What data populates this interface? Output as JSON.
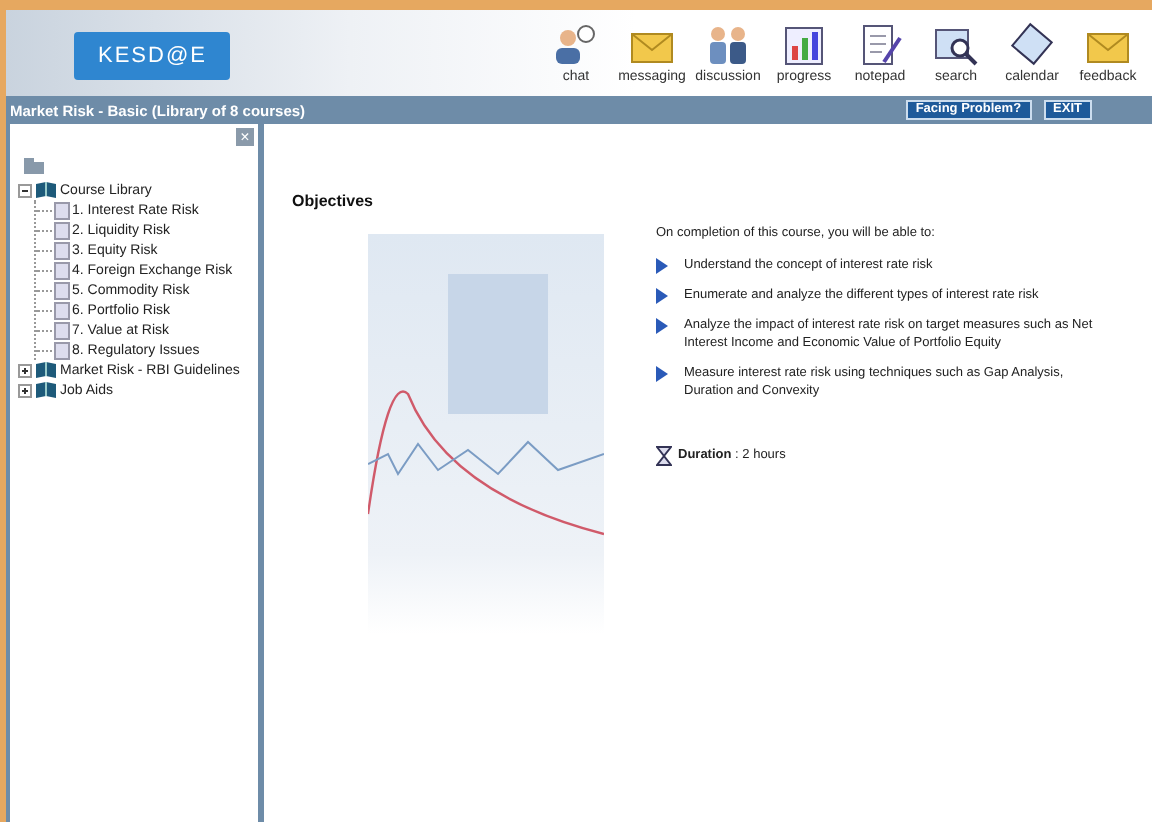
{
  "header": {
    "logo": "KESD@E",
    "tools": [
      {
        "label": "chat"
      },
      {
        "label": "messaging"
      },
      {
        "label": "discussion"
      },
      {
        "label": "progress"
      },
      {
        "label": "notepad"
      },
      {
        "label": "search"
      },
      {
        "label": "calendar"
      },
      {
        "label": "feedback"
      }
    ]
  },
  "title_bar": {
    "title": "Market Risk - Basic (Library of 8 courses)",
    "buttons": [
      "Facing Problem?",
      "EXIT"
    ]
  },
  "sidebar": {
    "close": "×",
    "tree": [
      {
        "label": "Course Library",
        "expanded": true,
        "children": [
          {
            "label": "1. Interest Rate Risk"
          },
          {
            "label": "2. Liquidity Risk"
          },
          {
            "label": "3. Equity Risk"
          },
          {
            "label": "4. Foreign Exchange Risk"
          },
          {
            "label": "5. Commodity Risk"
          },
          {
            "label": "6. Portfolio Risk"
          },
          {
            "label": "7. Value at Risk"
          },
          {
            "label": "8. Regulatory Issues"
          }
        ]
      },
      {
        "label": "Market Risk - RBI Guidelines",
        "expanded": false
      },
      {
        "label": "Job Aids",
        "expanded": false
      }
    ]
  },
  "content": {
    "heading": "Objectives",
    "intro": "On completion of this course, you will be able to:",
    "objectives": [
      "Understand the concept of interest rate risk",
      "Enumerate and analyze the different types of interest rate risk",
      "Analyze the impact of interest rate risk on target measures such as Net Interest Income and Economic Value of Portfolio Equity",
      "Measure interest rate risk using techniques such as Gap Analysis, Duration and Convexity"
    ],
    "duration": "**Duration** : 2 hours"
  }
}
